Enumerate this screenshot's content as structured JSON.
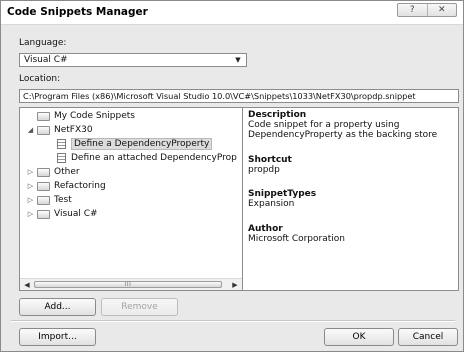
{
  "window": {
    "title": "Code Snippets Manager",
    "caption_buttons": [
      "?",
      "✕"
    ]
  },
  "language": {
    "label": "Language:",
    "selected": "Visual C#"
  },
  "location": {
    "label": "Location:",
    "path": "C:\\Program Files (x86)\\Microsoft Visual Studio 10.0\\VC#\\Snippets\\1033\\NetFX30\\propdp.snippet"
  },
  "tree": {
    "items": [
      {
        "label": "My Code Snippets",
        "type": "folder",
        "expander": ""
      },
      {
        "label": "NetFX30",
        "type": "folder",
        "expander": "◢"
      },
      {
        "label": "Define a DependencyProperty",
        "type": "snippet",
        "expander": ""
      },
      {
        "label": "Define an attached DependencyProp",
        "type": "snippet",
        "expander": ""
      },
      {
        "label": "Other",
        "type": "folder",
        "expander": "▷"
      },
      {
        "label": "Refactoring",
        "type": "folder",
        "expander": "▷"
      },
      {
        "label": "Test",
        "type": "folder",
        "expander": "▷"
      },
      {
        "label": "Visual C#",
        "type": "folder",
        "expander": "▷"
      }
    ],
    "selected_index": 2,
    "scroll_grip": "III"
  },
  "details": {
    "description_heading": "Description",
    "description_line1": "Code snippet for a property using",
    "description_line2": "DependencyProperty as the backing store",
    "shortcut_heading": "Shortcut",
    "shortcut_value": "propdp",
    "types_heading": "SnippetTypes",
    "types_value": "Expansion",
    "author_heading": "Author",
    "author_value": "Microsoft Corporation"
  },
  "buttons": {
    "add": "Add...",
    "remove": "Remove",
    "import": "Import...",
    "ok": "OK",
    "cancel": "Cancel"
  }
}
